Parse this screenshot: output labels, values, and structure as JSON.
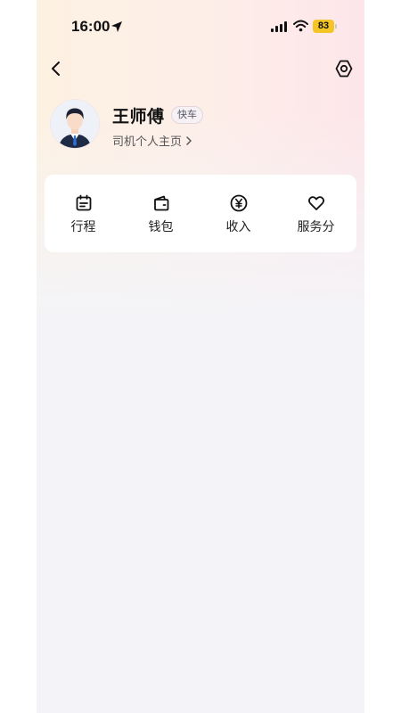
{
  "status_bar": {
    "time": "16:00",
    "battery": "83",
    "battery_color": "#f4c524"
  },
  "header": {
    "back_icon": "chevron-left-icon",
    "settings_icon": "settings-icon"
  },
  "profile": {
    "name": "王师傅",
    "badge": "快车",
    "homepage_link": "司机个人主页",
    "avatar_icon": "driver-avatar"
  },
  "menu": {
    "items": [
      {
        "label": "行程",
        "icon": "calendar-icon"
      },
      {
        "label": "钱包",
        "icon": "wallet-icon"
      },
      {
        "label": "收入",
        "icon": "yuan-icon"
      },
      {
        "label": "服务分",
        "icon": "heart-icon"
      }
    ]
  },
  "colors": {
    "background": "#f4f4f8",
    "gradient_start": "#fdf1e2",
    "gradient_end": "#fde6ea"
  }
}
